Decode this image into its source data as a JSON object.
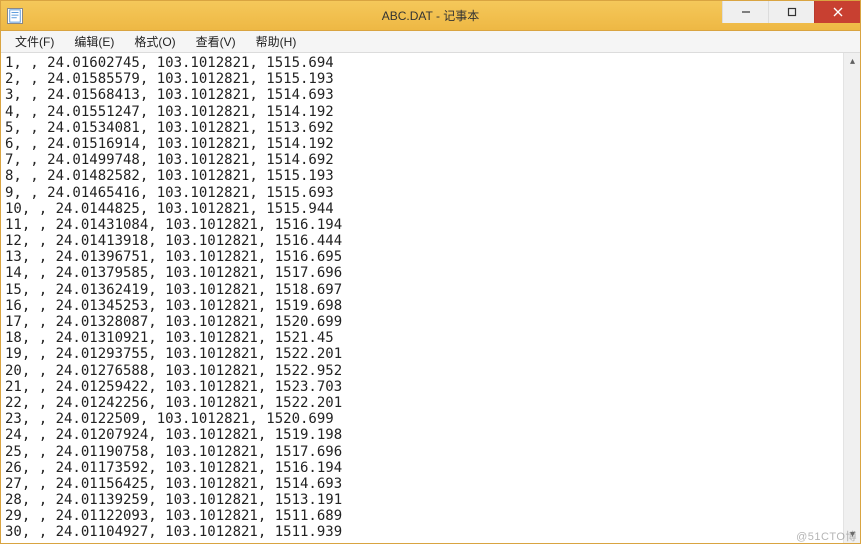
{
  "window": {
    "title": "ABC.DAT - 记事本",
    "app_icon_label": "notepad-icon"
  },
  "controls": {
    "minimize": "─",
    "maximize": "☐",
    "close": "✕"
  },
  "menubar": {
    "items": [
      {
        "label": "文件(F)"
      },
      {
        "label": "编辑(E)"
      },
      {
        "label": "格式(O)"
      },
      {
        "label": "查看(V)"
      },
      {
        "label": "帮助(H)"
      }
    ]
  },
  "content": {
    "lines": [
      "1, , 24.01602745, 103.1012821, 1515.694",
      "2, , 24.01585579, 103.1012821, 1515.193",
      "3, , 24.01568413, 103.1012821, 1514.693",
      "4, , 24.01551247, 103.1012821, 1514.192",
      "5, , 24.01534081, 103.1012821, 1513.692",
      "6, , 24.01516914, 103.1012821, 1514.192",
      "7, , 24.01499748, 103.1012821, 1514.692",
      "8, , 24.01482582, 103.1012821, 1515.193",
      "9, , 24.01465416, 103.1012821, 1515.693",
      "10, , 24.0144825, 103.1012821, 1515.944",
      "11, , 24.01431084, 103.1012821, 1516.194",
      "12, , 24.01413918, 103.1012821, 1516.444",
      "13, , 24.01396751, 103.1012821, 1516.695",
      "14, , 24.01379585, 103.1012821, 1517.696",
      "15, , 24.01362419, 103.1012821, 1518.697",
      "16, , 24.01345253, 103.1012821, 1519.698",
      "17, , 24.01328087, 103.1012821, 1520.699",
      "18, , 24.01310921, 103.1012821, 1521.45",
      "19, , 24.01293755, 103.1012821, 1522.201",
      "20, , 24.01276588, 103.1012821, 1522.952",
      "21, , 24.01259422, 103.1012821, 1523.703",
      "22, , 24.01242256, 103.1012821, 1522.201",
      "23, , 24.0122509, 103.1012821, 1520.699",
      "24, , 24.01207924, 103.1012821, 1519.198",
      "25, , 24.01190758, 103.1012821, 1517.696",
      "26, , 24.01173592, 103.1012821, 1516.194",
      "27, , 24.01156425, 103.1012821, 1514.693",
      "28, , 24.01139259, 103.1012821, 1513.191",
      "29, , 24.01122093, 103.1012821, 1511.689",
      "30, , 24.01104927, 103.1012821, 1511.939"
    ]
  },
  "scrollbar": {
    "up_arrow": "▴",
    "down_arrow": "▾"
  },
  "watermark": "@51CTO博"
}
